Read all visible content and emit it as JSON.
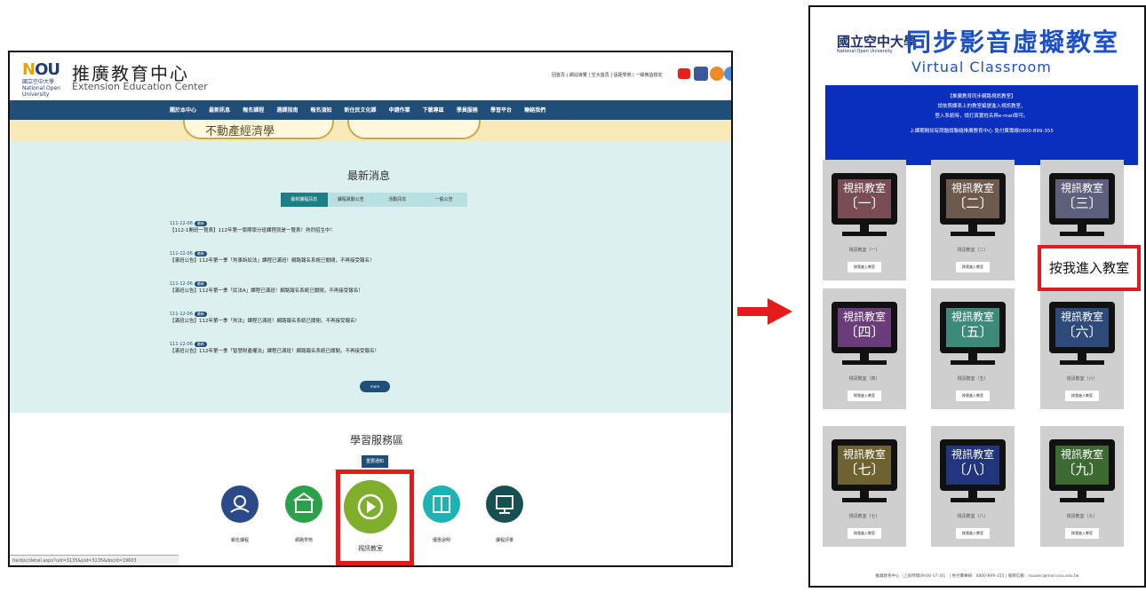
{
  "left_site": {
    "logo_text": "NOU",
    "university": "國立空中大學 National Open University",
    "title_zh": "推廣教育中心",
    "title_en": "Extension Education Center",
    "top_links": "回首頁 | 網站導覽 | 空大首頁 | 遠距學苑 | 一級英語檢定 ",
    "nav": [
      "關於本中心",
      "最新訊息",
      "報名課程",
      "選課指南",
      "報名須知",
      "新住民文化課",
      "申請作業",
      "下載專區",
      "學員服務",
      "學習平台",
      "聯絡我們"
    ],
    "banner_text": "不動產經濟學",
    "news": {
      "title": "最新消息",
      "tabs": [
        "最新課程訊息",
        "課程異動公告",
        "活動訊息",
        "一般公告"
      ],
      "badge": "最新",
      "items": [
        {
          "date": "111-12-06",
          "text": "【112-1開班一覽表】112年第一學期學分班課程就是一覽表！熱烈招生中！"
        },
        {
          "date": "111-12-06",
          "text": "【滿班公告】112年第一季「刑事訴訟法」課程已滿班！網路報名系統已關閉，不再接受報名！"
        },
        {
          "date": "111-12-06",
          "text": "【滿班公告】112年第一季「民法A」課程已滿班！網路報名系統已關閉，不再接受報名！"
        },
        {
          "date": "111-12-06",
          "text": "【滿班公告】112年第一季「刑法」課程已滿班！網路報名系統已關閉，不再接受報名！"
        },
        {
          "date": "111-12-06",
          "text": "【滿班公告】112年第一季「智慧財產權法」課程已滿班！網路報名系統已關閉，不再接受報名！"
        }
      ],
      "more": "more"
    },
    "service": {
      "title": "學習服務區",
      "button": "重要通知",
      "items": [
        {
          "label": "報名課程",
          "color": "#2b4a8a"
        },
        {
          "label": "網路學苑",
          "color": "#2aa14a"
        },
        {
          "label": "視訊教室",
          "color": "#7fae2c"
        },
        {
          "label": "優惠說明",
          "color": "#1bb3b3"
        },
        {
          "label": "課程評量",
          "color": "#184f53"
        }
      ]
    },
    "status_url": "ite/doc/detail.aspx?uid=3135&pid=3135&docid=19603"
  },
  "right_site": {
    "logo_zh": "國立空中大學",
    "logo_en": "National Open University",
    "title_zh": "同步影音虛擬教室",
    "title_en": "Virtual Classroom",
    "notice": [
      "【推廣教育同步網路視訊教室】",
      "請依照課表上的教室編號進入視訊教室，",
      "登入系統時，請打真實姓名與e-mail即可。",
      "上課期間如有問題請聯絡推廣教育中心 免付費專線0800-899-355"
    ],
    "room_title": "視訊教室",
    "rooms": [
      {
        "num": "〔一〕",
        "label": "視訊教室（一）",
        "button": "按我進入教室",
        "color": "#7a4c55"
      },
      {
        "num": "〔二〕",
        "label": "視訊教室（二）",
        "button": "按我進入教室",
        "color": "#6e5a4d"
      },
      {
        "num": "〔三〕",
        "label": "視訊教室（三）",
        "button": "按我進入教室",
        "color": "#5e5f7a"
      },
      {
        "num": "〔四〕",
        "label": "視訊教室（四）",
        "button": "按我進入教室",
        "color": "#6a3c7a"
      },
      {
        "num": "〔五〕",
        "label": "視訊教室（五）",
        "button": "按我進入教室",
        "color": "#3e8a7a"
      },
      {
        "num": "〔六〕",
        "label": "視訊教室（六）",
        "button": "按我進入教室",
        "color": "#2e4a7a"
      },
      {
        "num": "〔七〕",
        "label": "視訊教室（七）",
        "button": "按我進入教室",
        "color": "#6e6330"
      },
      {
        "num": "〔八〕",
        "label": "視訊教室（八）",
        "button": "按我進入教室",
        "color": "#22347e"
      },
      {
        "num": "〔九〕",
        "label": "視訊教室（九）",
        "button": "按我進入教室",
        "color": "#3c6a32"
      }
    ],
    "callout": "按我進入教室",
    "footer": "推廣教育中心（上班時間09:00-17:30）  |  免付費專線：0800-899-355  |  服務信箱：nouaec@mail.nou.edu.tw"
  },
  "accent_red": "#e31b1b"
}
